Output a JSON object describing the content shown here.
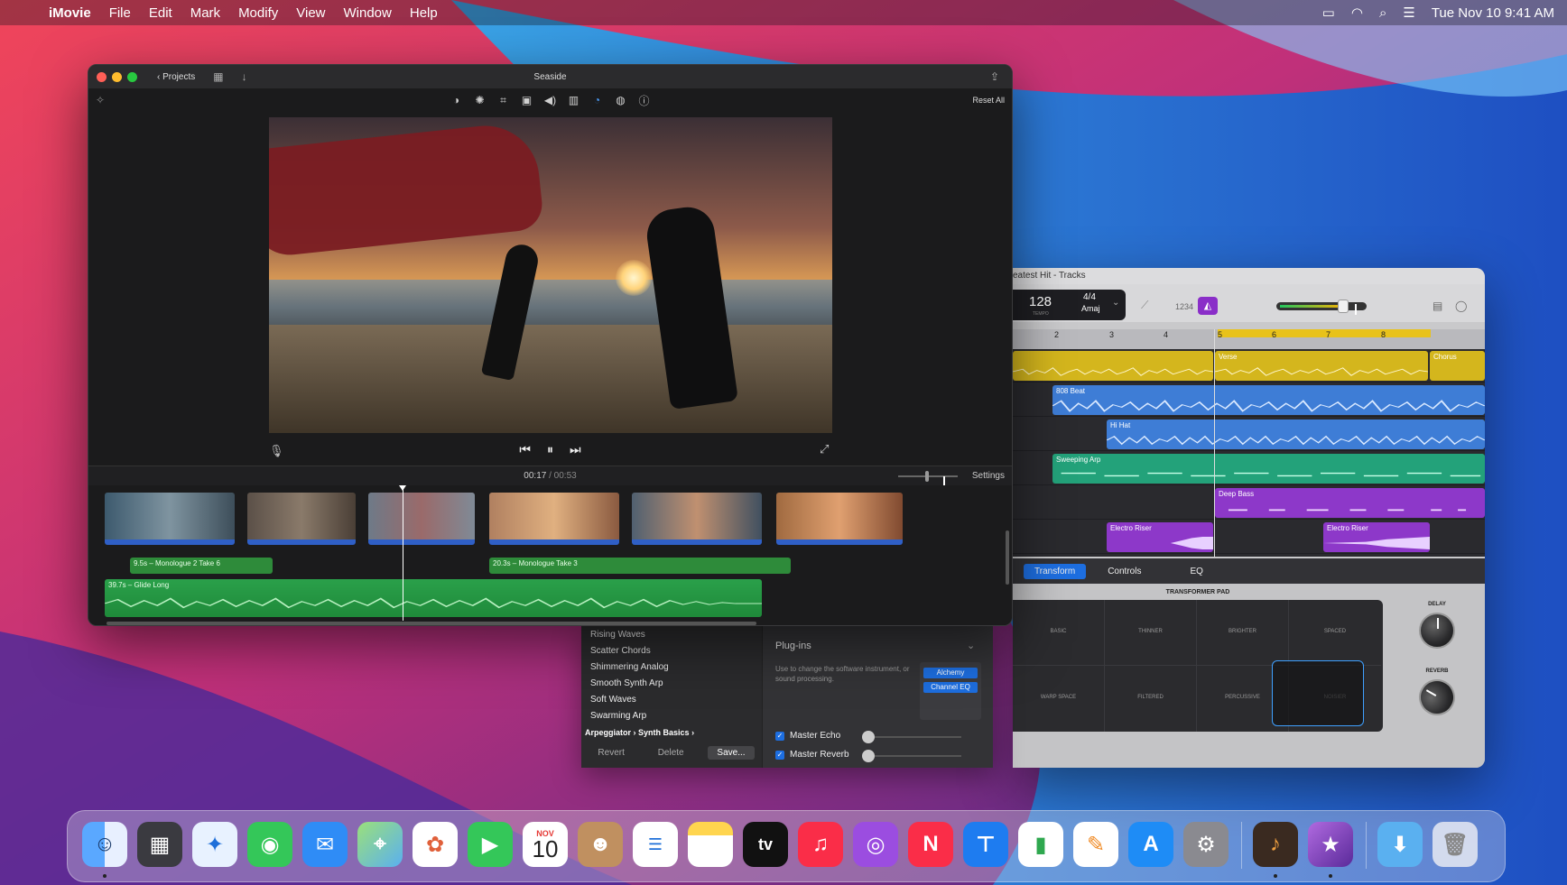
{
  "menubar": {
    "app_name": "iMovie",
    "items": [
      "File",
      "Edit",
      "Mark",
      "Modify",
      "View",
      "Window",
      "Help"
    ],
    "clock": "Tue Nov 10  9:41 AM"
  },
  "imovie": {
    "projects_label": "Projects",
    "title": "Seaside",
    "reset_all": "Reset All",
    "time_current": "00:17",
    "time_sep": "/",
    "time_total": "00:53",
    "settings_label": "Settings",
    "clips": {
      "audio1": "9.5s – Monologue 2 Take 6",
      "audio2": "20.3s – Monologue Take 3",
      "music": "39.7s – Glide Long"
    }
  },
  "garageband": {
    "title": "eatest Hit - Tracks",
    "tempo": "128",
    "tempo_label": "TEMPO",
    "time_signature": "4/4",
    "key": "Amaj",
    "count_in": "1234",
    "ruler": [
      "2",
      "3",
      "4",
      "5",
      "6",
      "7",
      "8"
    ],
    "regions": {
      "verse": "Verse",
      "chorus": "Chorus",
      "beat": "808 Beat",
      "hihat": "Hi Hat",
      "arp": "Sweeping Arp",
      "bass": "Deep Bass",
      "riser1": "Electro Riser",
      "riser2": "Electro Riser"
    },
    "tabs": [
      "Transform",
      "Controls",
      "EQ"
    ],
    "pad_title": "TRANSFORMER PAD",
    "pad_cells": [
      "BASIC",
      "THINNER",
      "BRIGHTER",
      "SPACED",
      "WARP SPACE",
      "FILTERED",
      "PERCUSSIVE",
      "NOISIER"
    ],
    "knob_delay": "DELAY",
    "knob_reverb": "REVERB"
  },
  "library": {
    "items": [
      "Rising Waves",
      "Scatter Chords",
      "Shimmering Analog",
      "Smooth Synth Arp",
      "Soft Waves",
      "Swarming Arp"
    ],
    "path_1": "Arpeggiator",
    "path_2": "Synth Basics",
    "revert": "Revert",
    "delete": "Delete",
    "save": "Save...",
    "plugins_header": "Plug-ins",
    "plugins_desc": "Use to change the software instrument, or sound processing.",
    "slot1": "Alchemy",
    "slot2": "Channel EQ",
    "master_echo": "Master Echo",
    "master_reverb": "Master Reverb"
  },
  "dock": {
    "calendar_month": "NOV",
    "calendar_day": "10",
    "tv_label": "tv"
  },
  "colors": {
    "accent_blue": "#1d6ee0",
    "region_yellow": "#d4b61d",
    "region_blue": "#3e7dd6",
    "region_teal": "#23a27a",
    "region_purple": "#8d38c9"
  }
}
